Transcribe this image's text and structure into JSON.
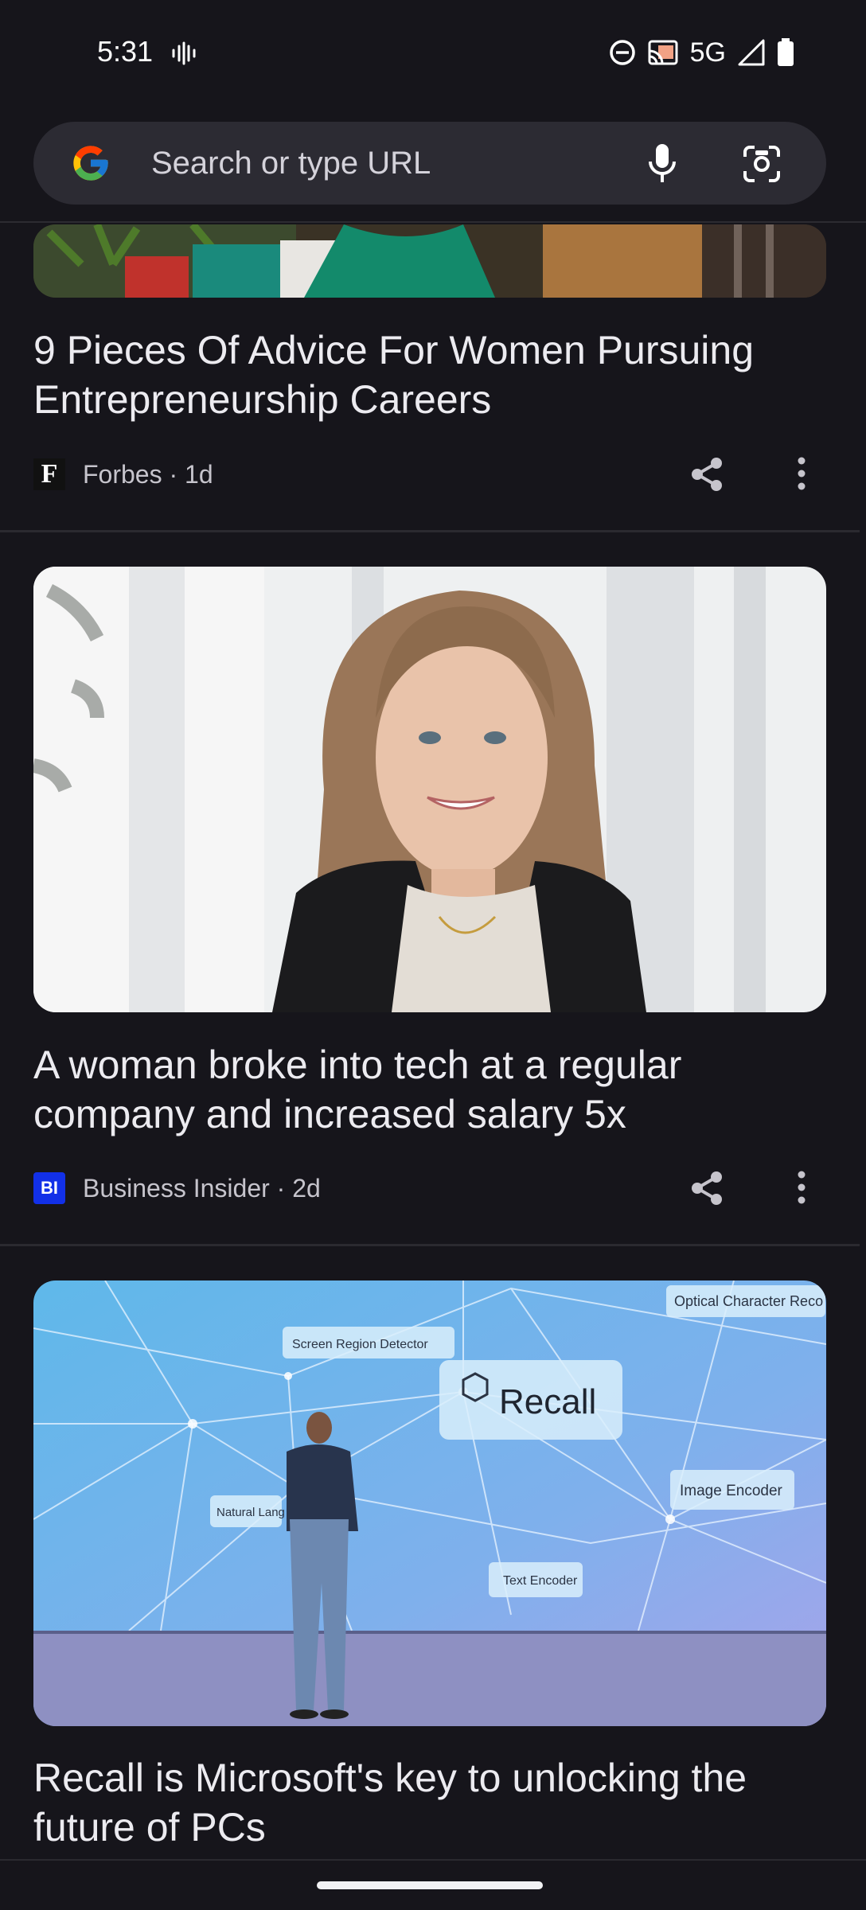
{
  "status": {
    "time": "5:31",
    "network": "5G",
    "icons": [
      "vibrate-icon",
      "dnd-icon",
      "cast-icon",
      "signal-icon",
      "battery-icon"
    ]
  },
  "search": {
    "placeholder": "Search or type URL",
    "icons": [
      "google-logo",
      "mic-icon",
      "lens-icon"
    ]
  },
  "articles": [
    {
      "title": "9 Pieces Of Advice For Women Pursuing Entrepreneurship Careers",
      "source": "Forbes",
      "age": "1d",
      "source_icon_text": "F"
    },
    {
      "title": "A woman broke into tech at a regular company and increased salary 5x",
      "source": "Business Insider",
      "age": "2d",
      "source_icon_text": "BI"
    },
    {
      "title": "Recall is Microsoft's key to unlocking the future of PCs",
      "image_labels": {
        "recall": "Recall",
        "screen_region": "Screen Region Detector",
        "ocr": "Optical Character Reco",
        "image_encoder": "Image Encoder",
        "text_encoder": "Text Encoder",
        "natural_lang": "Natural Lang"
      }
    }
  ],
  "meta_separator": " · ",
  "colors": {
    "background": "#16151b",
    "search_bg": "#2c2b33",
    "bi_blue": "#1230e8"
  }
}
